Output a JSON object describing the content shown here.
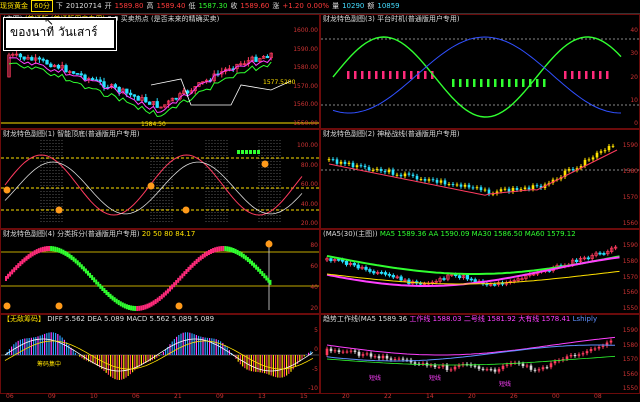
{
  "topbar": {
    "items": [
      {
        "text": "现货黄金",
        "color": "yellow"
      },
      {
        "text": "60分",
        "color": "yellow",
        "boxed": true
      },
      {
        "text": "下",
        "color": "white"
      },
      {
        "text": "20120714",
        "color": "white"
      },
      {
        "text": "开",
        "color": "white"
      },
      {
        "text": "1589.80",
        "color": "red"
      },
      {
        "text": "高",
        "color": "white"
      },
      {
        "text": "1589.40",
        "color": "red"
      },
      {
        "text": "低",
        "color": "white"
      },
      {
        "text": "1587.30",
        "color": "green"
      },
      {
        "text": "收",
        "color": "white"
      },
      {
        "text": "1589.60",
        "color": "red"
      },
      {
        "text": "涨",
        "color": "white"
      },
      {
        "text": "+1.20",
        "color": "red"
      },
      {
        "text": "0.00%",
        "color": "red"
      },
      {
        "text": "量",
        "color": "white"
      },
      {
        "text": "10290",
        "color": "cyan"
      },
      {
        "text": "额",
        "color": "white"
      },
      {
        "text": "10859",
        "color": "cyan"
      }
    ]
  },
  "callout": {
    "left_text": "ของนาที",
    "right_text": "วันเสาร์"
  },
  "panels": {
    "p1": {
      "title": "(主图)",
      "title2": "(普通版 (普通版用户专用)",
      "title3": "0   0   买卖热点 (是否未来的精确买卖)",
      "labels": [
        "1577.5200",
        "1584.50"
      ],
      "axis": [
        "1600.00",
        "1590.00",
        "1580.00",
        "1570.00",
        "1560.00",
        "1550.00"
      ]
    },
    "p2": {
      "title": "财龙特色副图(3) 平台时机(普通版用户专用)",
      "axis": [
        "40",
        "30",
        "20",
        "10",
        "0"
      ]
    },
    "p3": {
      "title": "财龙特色副图(1) 智能顶底(普通版用户专用)",
      "axis": [
        "100.00",
        "80.00",
        "60.00",
        "40.00",
        "20.00"
      ]
    },
    "p4": {
      "title": "财龙特色副图(2) 神秘战线(普通版用户专用)",
      "axis": [
        "1590",
        "1580",
        "1570",
        "1560"
      ]
    },
    "p5": {
      "title": "财龙特色副图(4) 分类拆分(普通版用户专用)",
      "title2": "20   50   80   84.17",
      "axis": [
        "80",
        "60",
        "40",
        "20"
      ]
    },
    "p6": {
      "title": "(MA5(30)(主图))",
      "title2": "MA5 1589.36  AA 1590.09  MA30 1586.50  MA60 1579.12",
      "axis": [
        "1590",
        "1580",
        "1570",
        "1560",
        "1550"
      ]
    },
    "p7": {
      "title": "【无敌筹码】",
      "title2": "DIFF 5.562  DEA 5.089  MACD 5.562  5.089  5.089",
      "axis": [
        "5",
        "0",
        "-5",
        "-10"
      ],
      "labels": [
        "筹码集中"
      ]
    },
    "p8": {
      "title": "趋势工作线(MA5 1589.36",
      "title2": "工作线 1588.03  二号线 1581.92  大有线 1578.41",
      "title3": "Lshiply",
      "axis": [
        "1590",
        "1580",
        "1570",
        "1560",
        "1550"
      ],
      "labels": [
        "短线",
        "短线",
        "短线"
      ]
    }
  },
  "xaxis": {
    "labels": [
      "06",
      "09",
      "10",
      "06",
      "21",
      "09",
      "13",
      "15",
      "20",
      "22",
      "14",
      "20",
      "26",
      "00",
      "08"
    ]
  },
  "colors": {
    "up": "#ff3b5f",
    "down": "#29e0ff",
    "bull": "#ff2a7a",
    "bear": "#30ff30",
    "panel_border": "#6b0b0b"
  }
}
